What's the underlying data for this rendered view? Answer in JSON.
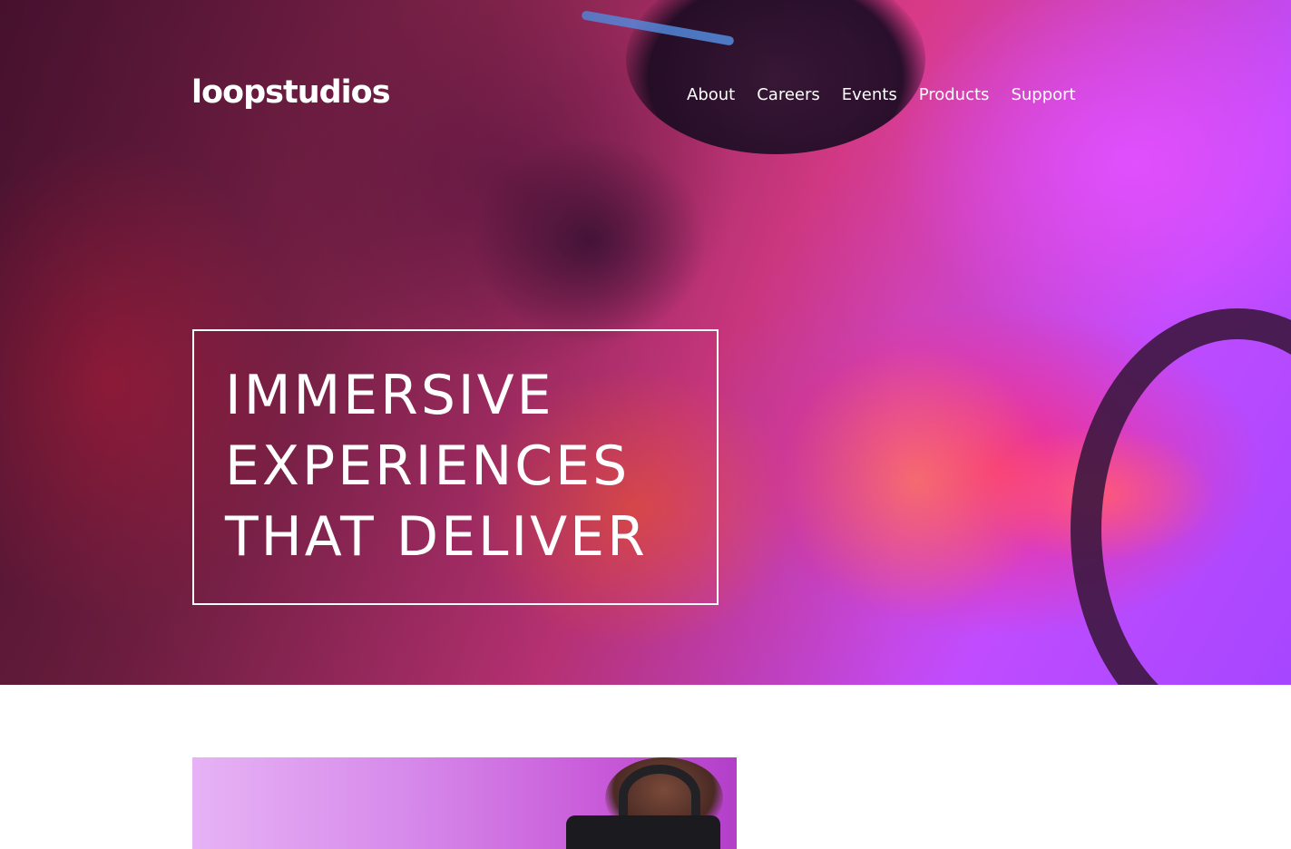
{
  "header": {
    "logo": "loopstudios",
    "nav": [
      "About",
      "Careers",
      "Events",
      "Products",
      "Support"
    ]
  },
  "hero": {
    "headline_lines": [
      "IMMERSIVE",
      "EXPERIENCES",
      "THAT DELIVER"
    ],
    "image": "woman-vr-headset-driving-wheel"
  },
  "interactive": {
    "image": "man-vr-headset"
  },
  "colors": {
    "hero_magenta": "#d83a88",
    "hero_violet": "#a646ff",
    "text_on_hero": "#ffffff",
    "page_background": "#ffffff"
  }
}
